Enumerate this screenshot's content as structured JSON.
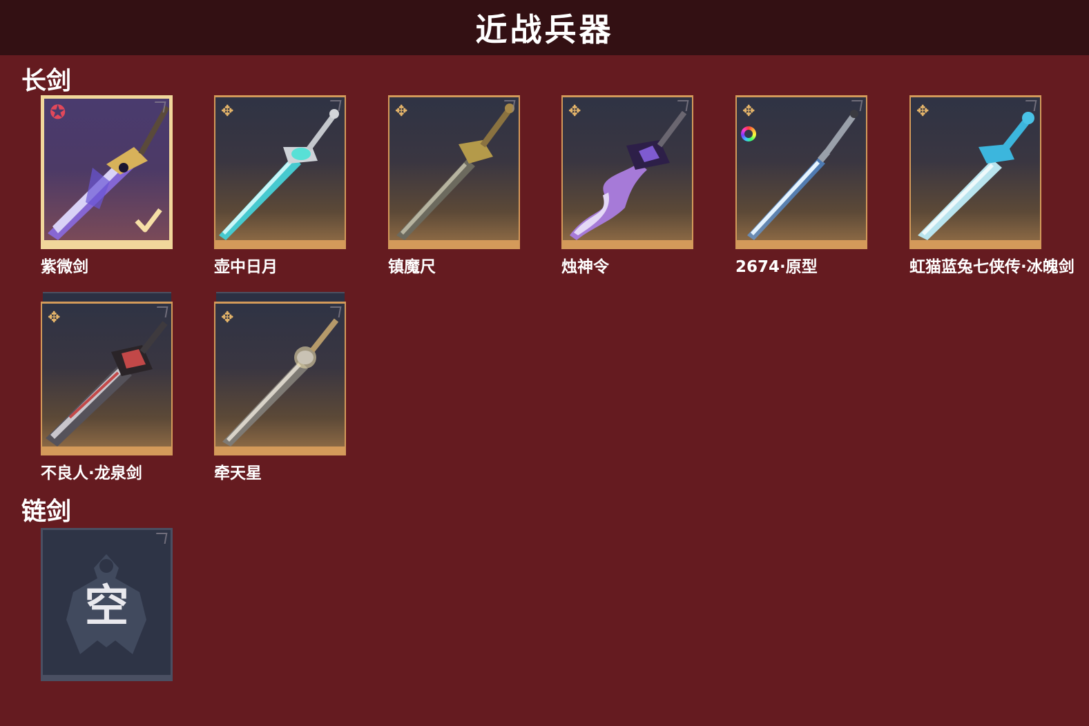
{
  "header": {
    "title": "近战兵器"
  },
  "sections": [
    {
      "title": "长剑",
      "items": [
        {
          "name": "紫微剑",
          "rarity_icon": "red-star-icon",
          "selected": true,
          "blade_color": "#8a6ae0"
        },
        {
          "name": "壶中日月",
          "rarity_icon": "gold-shuriken-icon",
          "selected": false,
          "blade_color": "#46c9cf"
        },
        {
          "name": "镇魔尺",
          "rarity_icon": "gold-shuriken-icon",
          "selected": false,
          "blade_color": "#b49a4a"
        },
        {
          "name": "烛神令",
          "rarity_icon": "gold-shuriken-icon",
          "selected": false,
          "blade_color": "#a67ad8"
        },
        {
          "name": "2674·原型",
          "rarity_icon": "gold-shuriken-icon",
          "selected": false,
          "blade_color": "#a9d4ff",
          "color_ring": true
        },
        {
          "name": "虹猫蓝兔七侠传·冰魄剑",
          "rarity_icon": "gold-shuriken-icon",
          "selected": false,
          "blade_color": "#8fd6ea"
        },
        {
          "name": "不良人·龙泉剑",
          "rarity_icon": "gold-shuriken-icon",
          "selected": false,
          "blade_color": "#c24848"
        },
        {
          "name": "牵天星",
          "rarity_icon": "gold-shuriken-icon",
          "selected": false,
          "blade_color": "#c9c2b4"
        }
      ]
    },
    {
      "title": "链剑",
      "items": [
        {
          "empty": true,
          "label": "空"
        }
      ]
    }
  ],
  "colors": {
    "background": "#651b20",
    "header": "#331013",
    "card_border": "#d49a5a",
    "selected_border": "#f1d79b",
    "empty_slot": "#2e3446"
  }
}
